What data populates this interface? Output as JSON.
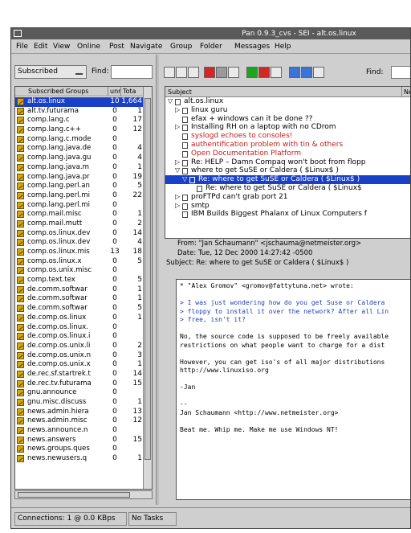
{
  "window": {
    "title": "Pan 0.9.3_cvs - SEI - alt.os.linux"
  },
  "menu": [
    "File",
    "Edit",
    "View",
    "Online",
    "Post",
    "Navigate",
    "Group",
    "Folder",
    "Messages",
    "Help"
  ],
  "group_filter": {
    "value": "Subscribed",
    "find_label": "Find:"
  },
  "group_list": {
    "columns": [
      "Subscribed Groups",
      "Unread",
      "Total"
    ],
    "header_visible": [
      "Subscribed Groups",
      "unr",
      "Tota"
    ],
    "rows": [
      {
        "name": "alt.os.linux",
        "unread": "10",
        "total": "1,664",
        "selected": true
      },
      {
        "name": "alt.tv.futurama",
        "unread": "0",
        "total": "1"
      },
      {
        "name": "comp.lang.c",
        "unread": "0",
        "total": "17"
      },
      {
        "name": "comp.lang.c++",
        "unread": "0",
        "total": "12"
      },
      {
        "name": "comp.lang.c.mode",
        "unread": "0",
        "total": ""
      },
      {
        "name": "comp.lang.java.de",
        "unread": "0",
        "total": "4"
      },
      {
        "name": "comp.lang.java.gu",
        "unread": "0",
        "total": "4"
      },
      {
        "name": "comp.lang.java.m",
        "unread": "0",
        "total": "1"
      },
      {
        "name": "comp.lang.java.pr",
        "unread": "0",
        "total": "19"
      },
      {
        "name": "comp.lang.perl.an",
        "unread": "0",
        "total": "5"
      },
      {
        "name": "comp.lang.perl.mi",
        "unread": "0",
        "total": "22"
      },
      {
        "name": "comp.lang.perl.mi",
        "unread": "0",
        "total": ""
      },
      {
        "name": "comp.mail.misc",
        "unread": "0",
        "total": "1"
      },
      {
        "name": "comp.mail.mutt",
        "unread": "0",
        "total": "2"
      },
      {
        "name": "comp.os.linux.dev",
        "unread": "0",
        "total": "14"
      },
      {
        "name": "comp.os.linux.dev",
        "unread": "0",
        "total": "4"
      },
      {
        "name": "comp.os.linux.mis",
        "unread": "13",
        "total": "18"
      },
      {
        "name": "comp.os.linux.x",
        "unread": "0",
        "total": "5"
      },
      {
        "name": "comp.os.unix.misc",
        "unread": "0",
        "total": ""
      },
      {
        "name": "comp.text.tex",
        "unread": "0",
        "total": "5"
      },
      {
        "name": "de.comm.softwar",
        "unread": "0",
        "total": "1"
      },
      {
        "name": "de.comm.softwar",
        "unread": "0",
        "total": "1"
      },
      {
        "name": "de.comm.softwar",
        "unread": "0",
        "total": "5"
      },
      {
        "name": "de.comp.os.linux",
        "unread": "0",
        "total": "1"
      },
      {
        "name": "de.comp.os.linux.",
        "unread": "0",
        "total": ""
      },
      {
        "name": "de.comp.os.linux.i",
        "unread": "0",
        "total": ""
      },
      {
        "name": "de.comp.os.unix.li",
        "unread": "0",
        "total": "2"
      },
      {
        "name": "de.comp.os.unix.n",
        "unread": "0",
        "total": "3"
      },
      {
        "name": "de.comp.os.unix.x",
        "unread": "0",
        "total": "1"
      },
      {
        "name": "de.rec.sf.startrek.t",
        "unread": "0",
        "total": "14"
      },
      {
        "name": "de.rec.tv.futurama",
        "unread": "0",
        "total": "15"
      },
      {
        "name": "gnu.announce",
        "unread": "0",
        "total": ""
      },
      {
        "name": "gnu.misc.discuss",
        "unread": "0",
        "total": "1"
      },
      {
        "name": "news.admin.hiera",
        "unread": "0",
        "total": "13"
      },
      {
        "name": "news.admin.misc",
        "unread": "0",
        "total": "12"
      },
      {
        "name": "news.announce.n",
        "unread": "0",
        "total": ""
      },
      {
        "name": "news.answers",
        "unread": "0",
        "total": "15"
      },
      {
        "name": "news.groups.ques",
        "unread": "0",
        "total": ""
      },
      {
        "name": "news.newusers.q",
        "unread": "0",
        "total": "1"
      }
    ]
  },
  "toolbar": {
    "find_label": "Find:"
  },
  "thread_pane": {
    "header": {
      "subject": "Subject",
      "ne": "Ne"
    },
    "rows": [
      {
        "indent": 0,
        "twist": "▽",
        "text": "alt.os.linux",
        "red": false
      },
      {
        "indent": 1,
        "twist": "▷",
        "text": "linux guru",
        "red": false
      },
      {
        "indent": 1,
        "twist": "",
        "text": "efax + windows can it be done ??",
        "red": false
      },
      {
        "indent": 1,
        "twist": "▷",
        "text": "Installing RH on a laptop with no CDrom",
        "red": false
      },
      {
        "indent": 1,
        "twist": "",
        "text": "syslogd echoes to consoles!",
        "red": true
      },
      {
        "indent": 1,
        "twist": "",
        "text": "authentification problem with tin & others",
        "red": true
      },
      {
        "indent": 1,
        "twist": "",
        "text": "Open Documentation Platform",
        "red": true
      },
      {
        "indent": 1,
        "twist": "▷",
        "text": "Re: HELP – Damn Compaq won't boot from flopp",
        "red": false
      },
      {
        "indent": 1,
        "twist": "▽",
        "text": "where to get SuSE or Caldera ( $Linux$ )",
        "red": false
      },
      {
        "indent": 2,
        "twist": "▽",
        "text": "Re: where to get SuSE or Caldera ( $Linux$ )",
        "red": false,
        "selected": true
      },
      {
        "indent": 3,
        "twist": "",
        "text": "Re: where to get SuSE or Caldera ( $Linux$",
        "red": false
      },
      {
        "indent": 1,
        "twist": "▷",
        "text": "proFTPd can't grab port 21",
        "red": false
      },
      {
        "indent": 1,
        "twist": "▷",
        "text": "smtp",
        "red": false
      },
      {
        "indent": 1,
        "twist": "",
        "text": "IBM Builds Biggest Phalanx of Linux Computers f",
        "red": false
      }
    ]
  },
  "article_header": {
    "from": "From: \"Jan Schaumann\" <jschauma@netmeister.org>",
    "date": "Date: Tue, 12 Dec 2000 14:27:42 -0500",
    "subject": "Subject: Re: where to get SuSE or Caldera ( $Linux$ )"
  },
  "article_body": [
    {
      "text": "* \"Alex Gromov\" <gromov@fattytuna.net> wrote:",
      "quote": false
    },
    {
      "text": "",
      "quote": false
    },
    {
      "text": "> I was just wondering how do you get Suse or Caldera",
      "quote": true
    },
    {
      "text": "> floppy to install it over the network? After all Lin",
      "quote": true
    },
    {
      "text": "> free, isn't it?",
      "quote": true
    },
    {
      "text": "",
      "quote": false
    },
    {
      "text": "No, the source code is supposed to be freely available",
      "quote": false
    },
    {
      "text": "restrictions on what people want to charge for a dist",
      "quote": false
    },
    {
      "text": "",
      "quote": false
    },
    {
      "text": "However, you can get iso's of all major distributions",
      "quote": false
    },
    {
      "text": "http://www.linuxiso.org",
      "quote": false
    },
    {
      "text": "",
      "quote": false
    },
    {
      "text": "-Jan",
      "quote": false
    },
    {
      "text": "",
      "quote": false
    },
    {
      "text": "--",
      "quote": false
    },
    {
      "text": "Jan Schaumann <http://www.netmeister.org>",
      "quote": false
    },
    {
      "text": "",
      "quote": false
    },
    {
      "text": "Beat me. Whip me. Make me use Windows NT!",
      "quote": false
    }
  ],
  "status": {
    "connections": "Connections: 1 @ 0.0 KBps",
    "tasks": "No Tasks"
  },
  "colors": {
    "selection": "#1840c8",
    "unread_red": "#c01c1c",
    "quote_blue": "#2040b8",
    "checkbox": "#d8a80a"
  }
}
